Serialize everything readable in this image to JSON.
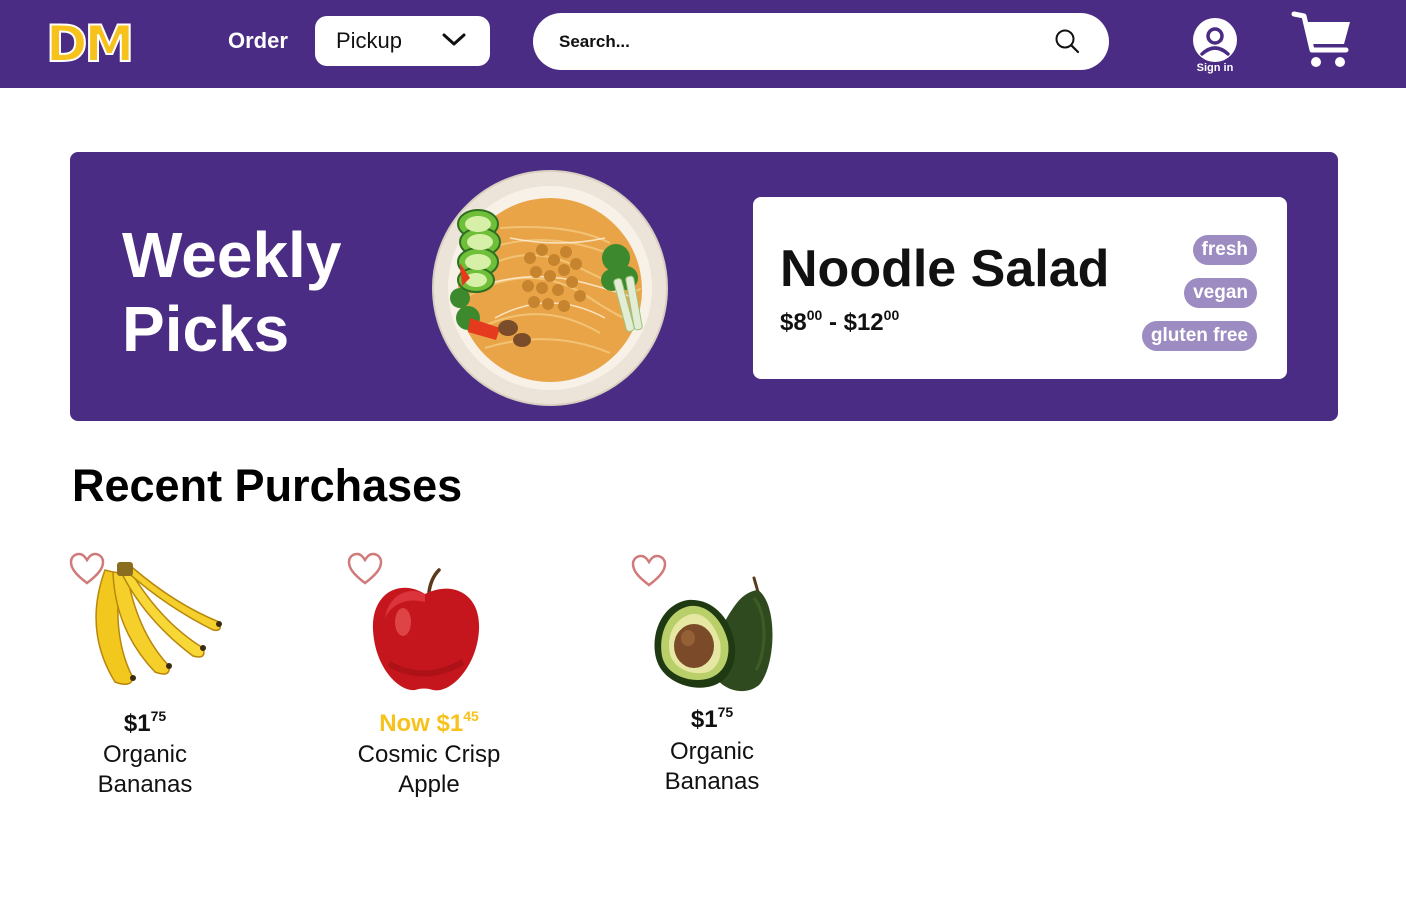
{
  "header": {
    "logo_text": "DM",
    "order_label": "Order",
    "order_mode": "Pickup",
    "search_placeholder": "Search...",
    "signin_label": "Sign in",
    "icons": [
      "chevron-down-icon",
      "search-icon",
      "user-icon",
      "cart-icon"
    ]
  },
  "banner": {
    "title": "Weekly Picks",
    "item": {
      "name": "Noodle Salad",
      "price_low_dollars": "$8",
      "price_low_cents": "00",
      "price_sep": " - ",
      "price_high_dollars": "$12",
      "price_high_cents": "00",
      "tags": [
        "fresh",
        "vegan",
        "gluten free"
      ]
    }
  },
  "recent": {
    "title": "Recent Purchases",
    "items": [
      {
        "price_prefix": "",
        "price_dollars": "$1",
        "price_cents": "75",
        "name_line1": "Organic",
        "name_line2": "Bananas",
        "image": "bananas"
      },
      {
        "price_prefix": "Now ",
        "price_dollars": "$1",
        "price_cents": "45",
        "name_line1": "Cosmic Crisp",
        "name_line2": "Apple",
        "image": "apple"
      },
      {
        "price_prefix": "",
        "price_dollars": "$1",
        "price_cents": "75",
        "name_line1": "Organic",
        "name_line2": "Bananas",
        "image": "avocado"
      }
    ]
  },
  "colors": {
    "brand_purple": "#4b2c84",
    "logo_yellow": "#f6c21b",
    "tag_lavender": "#9d8cc1",
    "sale_yellow": "#f6c21b",
    "heart_red": "#d07a7a"
  }
}
